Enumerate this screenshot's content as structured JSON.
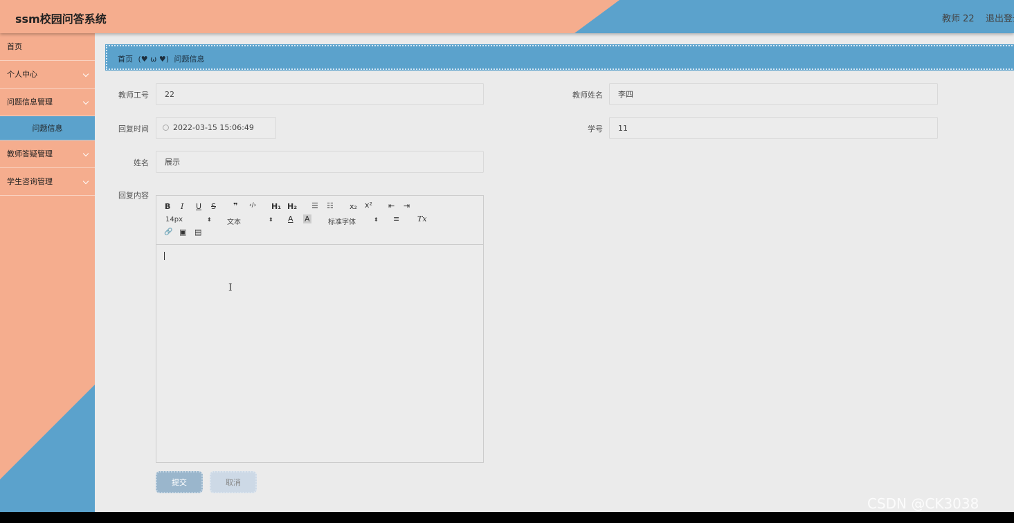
{
  "header": {
    "title": "ssm校园问答系统",
    "user": "教师 22",
    "logout": "退出登录"
  },
  "sidebar": {
    "items": [
      {
        "label": "首页"
      },
      {
        "label": "个人中心"
      },
      {
        "label": "问题信息管理"
      },
      {
        "label": "问题信息"
      },
      {
        "label": "教师答疑管理"
      },
      {
        "label": "学生咨询管理"
      }
    ]
  },
  "breadcrumb": {
    "home": "首页",
    "separator": "(♥ ω ♥)",
    "current": "问题信息"
  },
  "form": {
    "teacher_id": {
      "label": "教师工号",
      "value": "22"
    },
    "teacher_name": {
      "label": "教师姓名",
      "value": "李四"
    },
    "reply_time": {
      "label": "回复时间",
      "value": "2022-03-15 15:06:49"
    },
    "student_id": {
      "label": "学号",
      "value": "11"
    },
    "name": {
      "label": "姓名",
      "value": "展示"
    },
    "reply_content": {
      "label": "回复内容"
    }
  },
  "editor": {
    "bold": "B",
    "italic": "I",
    "underline": "U",
    "strike": "S",
    "quote": "❞",
    "code": "‹/›",
    "h1": "H₁",
    "h2": "H₂",
    "ordered_list": "☰",
    "bullet_list": "☷",
    "subscript": "x₂",
    "superscript": "x²",
    "outdent": "⇤",
    "indent": "⇥",
    "size": "14px",
    "header_select": "文本",
    "font_select": "标准字体",
    "align": "≡",
    "clean": "Tx",
    "link": "🔗",
    "image": "▣",
    "video": "▤"
  },
  "buttons": {
    "submit": "提交",
    "cancel": "取消"
  },
  "watermark": "CSDN @CK3038"
}
